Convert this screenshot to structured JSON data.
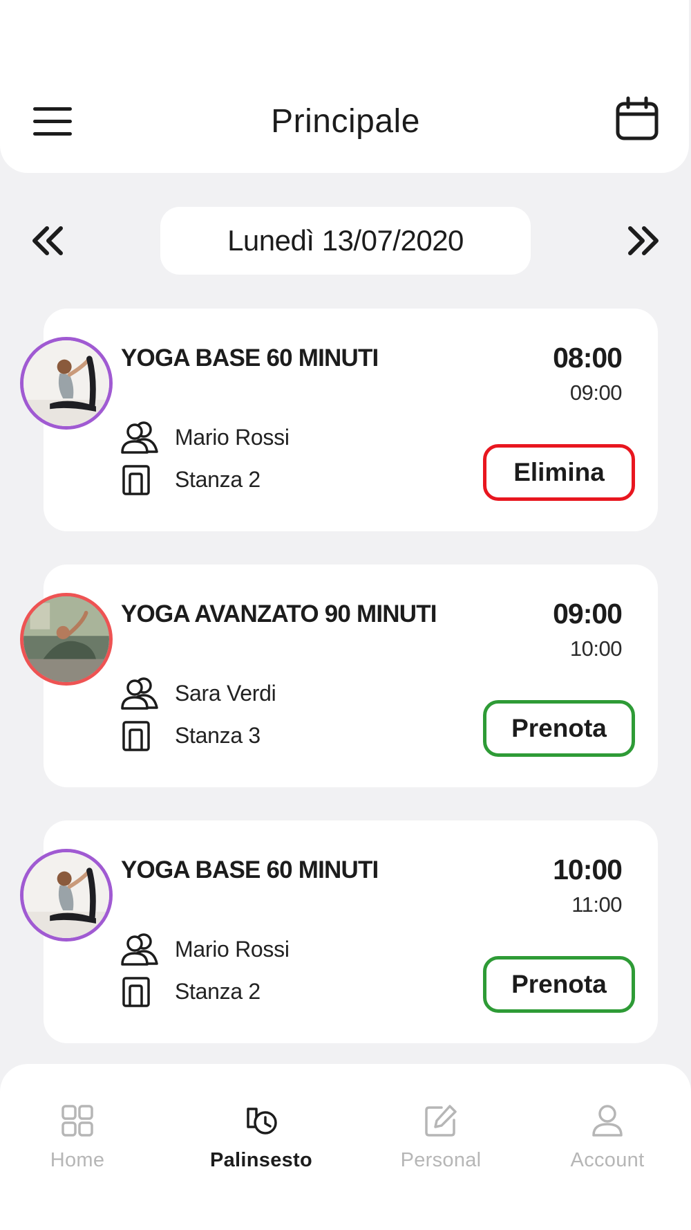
{
  "header": {
    "title": "Principale",
    "menu_icon": "hamburger-menu-icon",
    "calendar_icon": "calendar-icon"
  },
  "date_nav": {
    "current_date": "Lunedì 13/07/2020",
    "prev_icon": "double-chevron-left-icon",
    "next_icon": "double-chevron-right-icon"
  },
  "lessons": [
    {
      "title": "YOGA BASE 60 MINUTI",
      "start": "08:00",
      "end": "09:00",
      "teacher": "Mario Rossi",
      "room": "Stanza 2",
      "action": "Elimina",
      "action_type": "delete",
      "avatar_ring_color": "#a05ad2"
    },
    {
      "title": "YOGA AVANZATO 90 MINUTI",
      "start": "09:00",
      "end": "10:00",
      "teacher": "Sara Verdi",
      "room": "Stanza 3",
      "action": "Prenota",
      "action_type": "book",
      "avatar_ring_color": "#ee5353"
    },
    {
      "title": "YOGA BASE 60 MINUTI",
      "start": "10:00",
      "end": "11:00",
      "teacher": "Mario Rossi",
      "room": "Stanza 2",
      "action": "Prenota",
      "action_type": "book",
      "avatar_ring_color": "#a05ad2"
    }
  ],
  "bottom_nav": {
    "items": [
      {
        "label": "Home",
        "icon": "grid-icon",
        "active": false
      },
      {
        "label": "Palinsesto",
        "icon": "schedule-history-icon",
        "active": true
      },
      {
        "label": "Personal",
        "icon": "edit-icon",
        "active": false
      },
      {
        "label": "Account",
        "icon": "user-icon",
        "active": false
      }
    ]
  },
  "colors": {
    "background": "#f1f1f3",
    "delete_border": "#e8161f",
    "book_border": "#2e9b36",
    "inactive_nav": "#b6b6b6"
  }
}
